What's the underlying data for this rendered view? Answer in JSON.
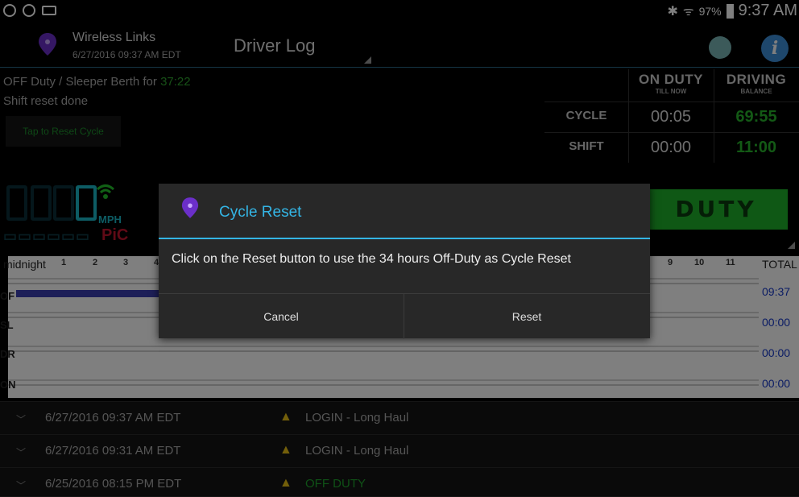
{
  "status_bar": {
    "battery": "97%",
    "time": "9:37 AM"
  },
  "app": {
    "name": "Wireless Links",
    "date": "6/27/2016 09:37 AM EDT",
    "spinner_label": "Driver Log"
  },
  "status": {
    "prefix": "OFF Duty / Sleeper Berth for ",
    "duration": "37:22",
    "shift_reset": "Shift reset done",
    "reset_cycle_button": "Tap to Reset Cycle"
  },
  "hours_table": {
    "col1_title": "ON DUTY",
    "col1_sub": "TILL NOW",
    "col2_title": "DRIVING",
    "col2_sub": "BALANCE",
    "rows": [
      {
        "label": "CYCLE",
        "on_duty": "00:05",
        "driving": "69:55"
      },
      {
        "label": "SHIFT",
        "on_duty": "00:00",
        "driving": "11:00"
      }
    ]
  },
  "speed": {
    "unit": "MPH",
    "pic": "PiC"
  },
  "duty_button": "DUTY",
  "graph": {
    "midnight_label": "midnight",
    "hour_labels_left": [
      "1",
      "2",
      "3",
      "4"
    ],
    "hour_labels_right": [
      "9",
      "10",
      "11"
    ],
    "total_label": "TOTAL",
    "rows": [
      {
        "label": "OF",
        "total": "09:37"
      },
      {
        "label": "SL",
        "total": "00:00"
      },
      {
        "label": "DR",
        "total": "00:00"
      },
      {
        "label": "ON",
        "total": "00:00"
      }
    ]
  },
  "log_entries": [
    {
      "date": "6/27/2016 09:37 AM EDT",
      "event": "LOGIN - Long Haul"
    },
    {
      "date": "6/27/2016 09:31 AM EDT",
      "event": "LOGIN - Long Haul"
    },
    {
      "date": "6/25/2016 08:15 PM EDT",
      "event": "OFF DUTY"
    }
  ],
  "dialog": {
    "title": "Cycle Reset",
    "message": "Click on the Reset button to use the 34 hours Off-Duty as Cycle Reset",
    "cancel": "Cancel",
    "reset": "Reset"
  },
  "colors": {
    "accent": "#34b5e5",
    "green": "#27b22b",
    "duty_green": "#1fb12a",
    "warn": "#e6bf15",
    "total_blue": "#1537c8"
  }
}
